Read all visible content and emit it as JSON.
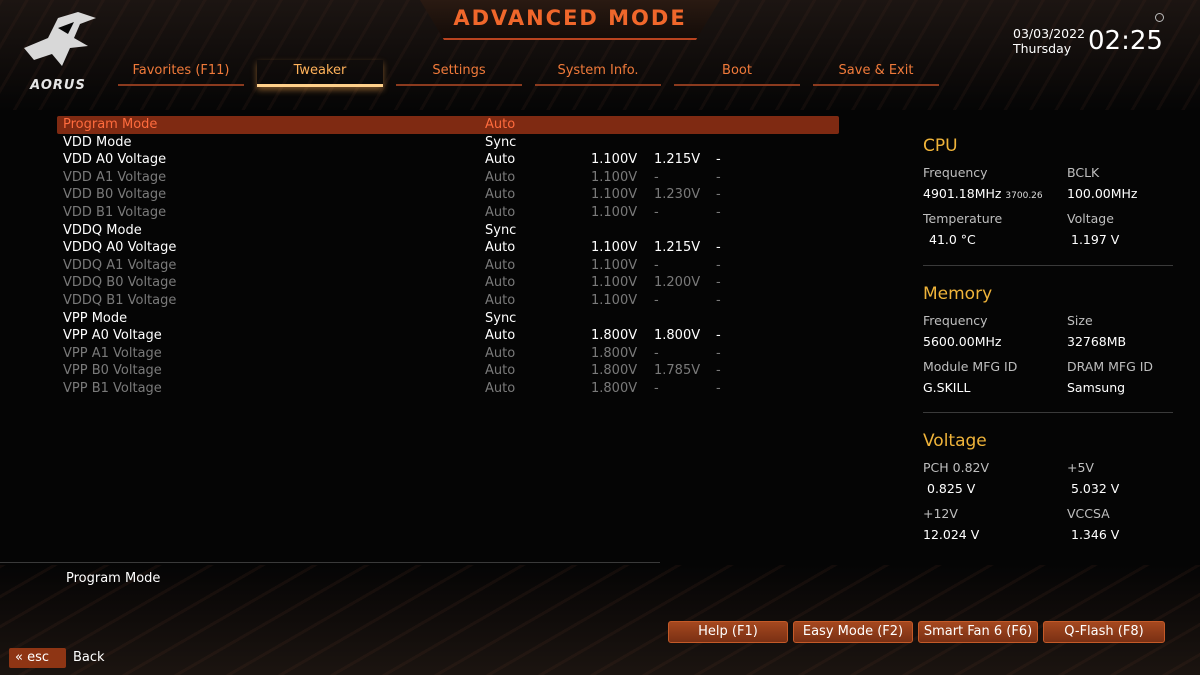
{
  "header": {
    "title": "ADVANCED MODE",
    "logo_text": "AORUS",
    "date": "03/03/2022",
    "day": "Thursday",
    "time": "02:25"
  },
  "tabs": [
    {
      "label": "Favorites (F11)",
      "active": false
    },
    {
      "label": "Tweaker",
      "active": true
    },
    {
      "label": "Settings",
      "active": false
    },
    {
      "label": "System Info.",
      "active": false
    },
    {
      "label": "Boot",
      "active": false
    },
    {
      "label": "Save & Exit",
      "active": false
    }
  ],
  "settings": [
    {
      "name": "Program Mode",
      "value": "Auto",
      "v1": "",
      "v2": "",
      "v3": "",
      "state": "selected"
    },
    {
      "name": "VDD Mode",
      "value": "Sync",
      "v1": "",
      "v2": "",
      "v3": "",
      "state": "normal"
    },
    {
      "name": "VDD A0 Voltage",
      "value": "Auto",
      "v1": "1.100V",
      "v2": "1.215V",
      "v3": "-",
      "state": "normal"
    },
    {
      "name": "VDD A1 Voltage",
      "value": "Auto",
      "v1": "1.100V",
      "v2": "-",
      "v3": "-",
      "state": "dim"
    },
    {
      "name": "VDD B0 Voltage",
      "value": "Auto",
      "v1": "1.100V",
      "v2": "1.230V",
      "v3": "-",
      "state": "dim"
    },
    {
      "name": "VDD B1 Voltage",
      "value": "Auto",
      "v1": "1.100V",
      "v2": "-",
      "v3": "-",
      "state": "dim"
    },
    {
      "name": "VDDQ Mode",
      "value": "Sync",
      "v1": "",
      "v2": "",
      "v3": "",
      "state": "normal"
    },
    {
      "name": "VDDQ A0 Voltage",
      "value": "Auto",
      "v1": "1.100V",
      "v2": "1.215V",
      "v3": "-",
      "state": "normal"
    },
    {
      "name": "VDDQ A1 Voltage",
      "value": "Auto",
      "v1": "1.100V",
      "v2": "-",
      "v3": "-",
      "state": "dim"
    },
    {
      "name": "VDDQ B0 Voltage",
      "value": "Auto",
      "v1": "1.100V",
      "v2": "1.200V",
      "v3": "-",
      "state": "dim"
    },
    {
      "name": "VDDQ B1 Voltage",
      "value": "Auto",
      "v1": "1.100V",
      "v2": "-",
      "v3": "-",
      "state": "dim"
    },
    {
      "name": "VPP Mode",
      "value": "Sync",
      "v1": "",
      "v2": "",
      "v3": "",
      "state": "normal"
    },
    {
      "name": "VPP A0 Voltage",
      "value": "Auto",
      "v1": "1.800V",
      "v2": "1.800V",
      "v3": "-",
      "state": "normal"
    },
    {
      "name": "VPP A1 Voltage",
      "value": "Auto",
      "v1": "1.800V",
      "v2": "-",
      "v3": "-",
      "state": "dim"
    },
    {
      "name": "VPP B0 Voltage",
      "value": "Auto",
      "v1": "1.800V",
      "v2": "1.785V",
      "v3": "-",
      "state": "dim"
    },
    {
      "name": "VPP B1 Voltage",
      "value": "Auto",
      "v1": "1.800V",
      "v2": "-",
      "v3": "-",
      "state": "dim"
    }
  ],
  "help": {
    "text": "Program Mode"
  },
  "cpu": {
    "heading": "CPU",
    "freq_label": "Frequency",
    "freq_value": "4901.18MHz",
    "freq_sub": "3700.26",
    "bclk_label": "BCLK",
    "bclk_value": "100.00MHz",
    "temp_label": "Temperature",
    "temp_value": "41.0 °C",
    "volt_label": "Voltage",
    "volt_value": "1.197 V"
  },
  "memory": {
    "heading": "Memory",
    "freq_label": "Frequency",
    "freq_value": "5600.00MHz",
    "size_label": "Size",
    "size_value": "32768MB",
    "module_label": "Module MFG ID",
    "module_value": "G.SKILL",
    "dram_label": "DRAM MFG ID",
    "dram_value": "Samsung"
  },
  "voltage": {
    "heading": "Voltage",
    "pch_label": "PCH 0.82V",
    "pch_value": "0.825 V",
    "v5_label": "+5V",
    "v5_value": "5.032 V",
    "v12_label": "+12V",
    "v12_value": "12.024 V",
    "vccsa_label": "VCCSA",
    "vccsa_value": "1.346 V"
  },
  "footer": {
    "buttons": [
      "Help (F1)",
      "Easy Mode (F2)",
      "Smart Fan 6 (F6)",
      "Q-Flash (F8)"
    ],
    "esc_label": "esc",
    "back_label": "Back"
  },
  "colors": {
    "accent": "#f0672b",
    "highlight_row": "#7f2a12",
    "panel_heading": "#f0b43a"
  }
}
